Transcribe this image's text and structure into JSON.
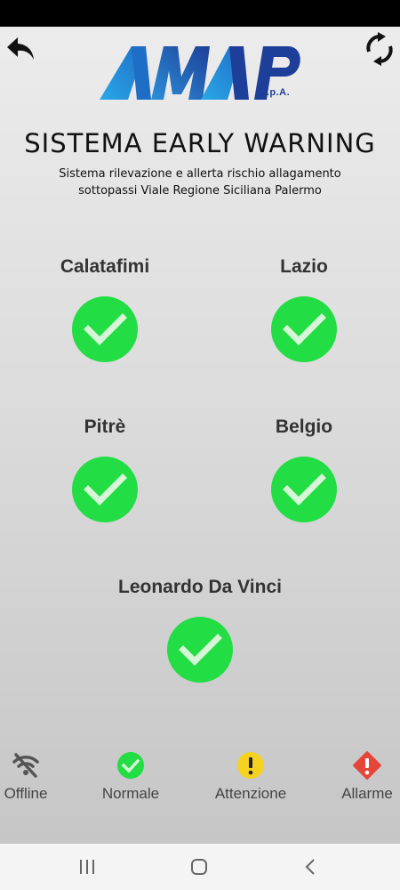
{
  "header": {
    "back_icon": "back-arrow-icon",
    "refresh_icon": "refresh-icon",
    "logo_text": "AMAP",
    "logo_suffix": "S.p.A.",
    "title": "SISTEMA EARLY WARNING",
    "subtitle_line1": "Sistema rilevazione e allerta rischio allagamento",
    "subtitle_line2": "sottopassi Viale Regione Siciliana Palermo"
  },
  "stations": [
    {
      "name": "Calatafimi",
      "status": "normale"
    },
    {
      "name": "Lazio",
      "status": "normale"
    },
    {
      "name": "Pitrè",
      "status": "normale"
    },
    {
      "name": "Belgio",
      "status": "normale"
    },
    {
      "name": "Leonardo Da Vinci",
      "status": "normale"
    }
  ],
  "legend": [
    {
      "label": "Offline",
      "icon": "wifi-off-icon",
      "color": "#555555"
    },
    {
      "label": "Normale",
      "icon": "check-circle-icon",
      "color": "#22dd44"
    },
    {
      "label": "Attenzione",
      "icon": "warning-circle-icon",
      "color": "#f5d21f"
    },
    {
      "label": "Allarme",
      "icon": "alarm-diamond-icon",
      "color": "#e5453a"
    }
  ],
  "colors": {
    "status_ok": "#22dd44",
    "logo_light_blue": "#2aa8e8",
    "logo_dark_blue": "#1e3f99"
  },
  "system_nav": {
    "recents_icon": "recents-icon",
    "home_icon": "home-icon",
    "back_icon": "system-back-icon"
  }
}
